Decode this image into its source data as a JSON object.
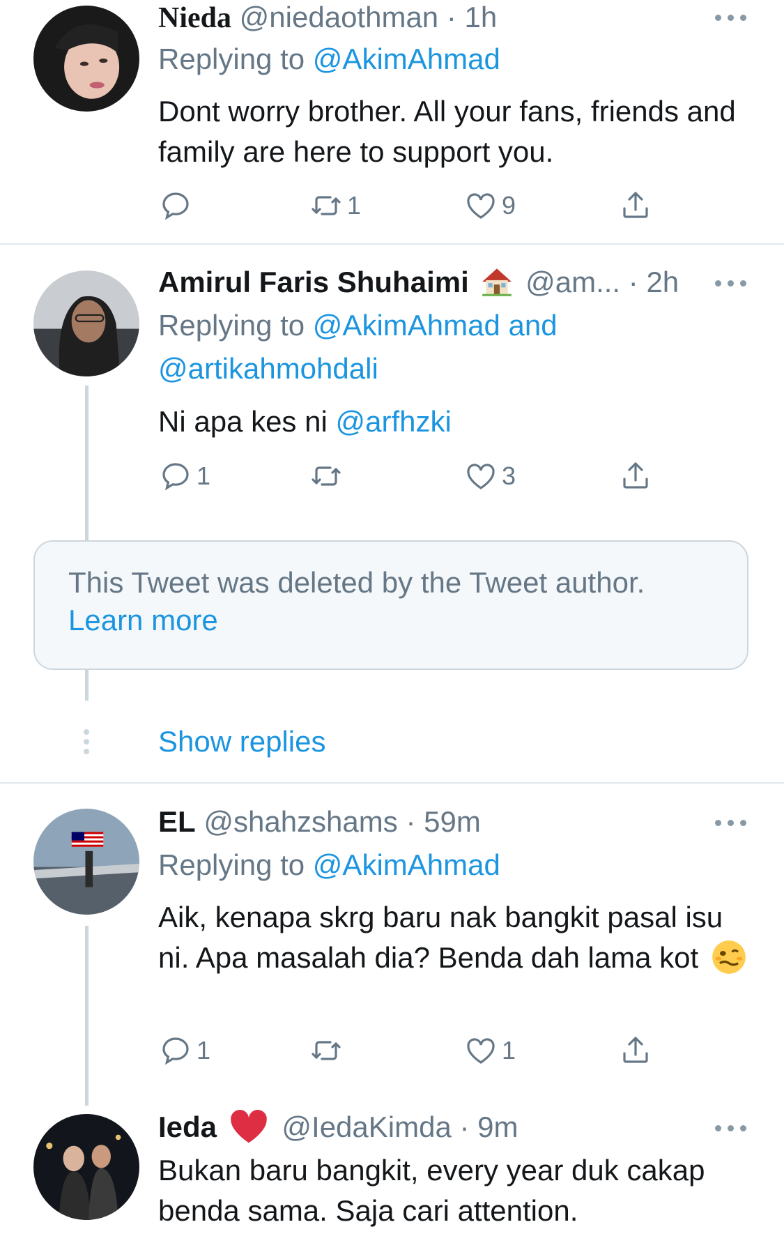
{
  "tweets": [
    {
      "name": "Nieda",
      "handle": "@niedaothman",
      "time": "1h",
      "replying_prefix": "Replying to ",
      "replying_to": "@AkimAhmad",
      "text": "Dont worry brother. All your fans, friends and family are here to support you.",
      "reply_count": "",
      "retweet_count": "1",
      "like_count": "9"
    },
    {
      "name": "Amirul Faris Shuhaimi",
      "name_emoji": "house-emoji",
      "handle": "@am...",
      "time": "2h",
      "replying_prefix": "Replying to ",
      "replying_to": "@AkimAhmad and",
      "replying_to_2": "@artikahmohdali",
      "text_prefix": "Ni apa kes ni ",
      "text_mention": "@arfhzki",
      "reply_count": "1",
      "retweet_count": "",
      "like_count": "3"
    },
    {
      "name": "EL",
      "handle": "@shahzshams",
      "time": "59m",
      "replying_prefix": "Replying to ",
      "replying_to": "@AkimAhmad",
      "text": "Aik, kenapa skrg baru nak bangkit pasal isu ni. Apa masalah dia? Benda dah lama kot",
      "text_emoji": "woozy-face-emoji",
      "reply_count": "1",
      "retweet_count": "",
      "like_count": "1"
    },
    {
      "name": "Ieda",
      "name_emoji": "red-heart-emoji",
      "handle": "@IedaKimda",
      "time": "9m",
      "text": "Bukan baru bangkit, every year duk cakap benda sama. Saja cari attention."
    }
  ],
  "deleted_notice": {
    "text": "This Tweet was deleted by the Tweet author.",
    "link": "Learn more"
  },
  "show_replies": "Show replies",
  "separator": "·",
  "colors": {
    "link": "#1b95e0",
    "secondary_text": "#657786",
    "divider": "#e1e8ed",
    "heart_red": "#dd2e44"
  }
}
